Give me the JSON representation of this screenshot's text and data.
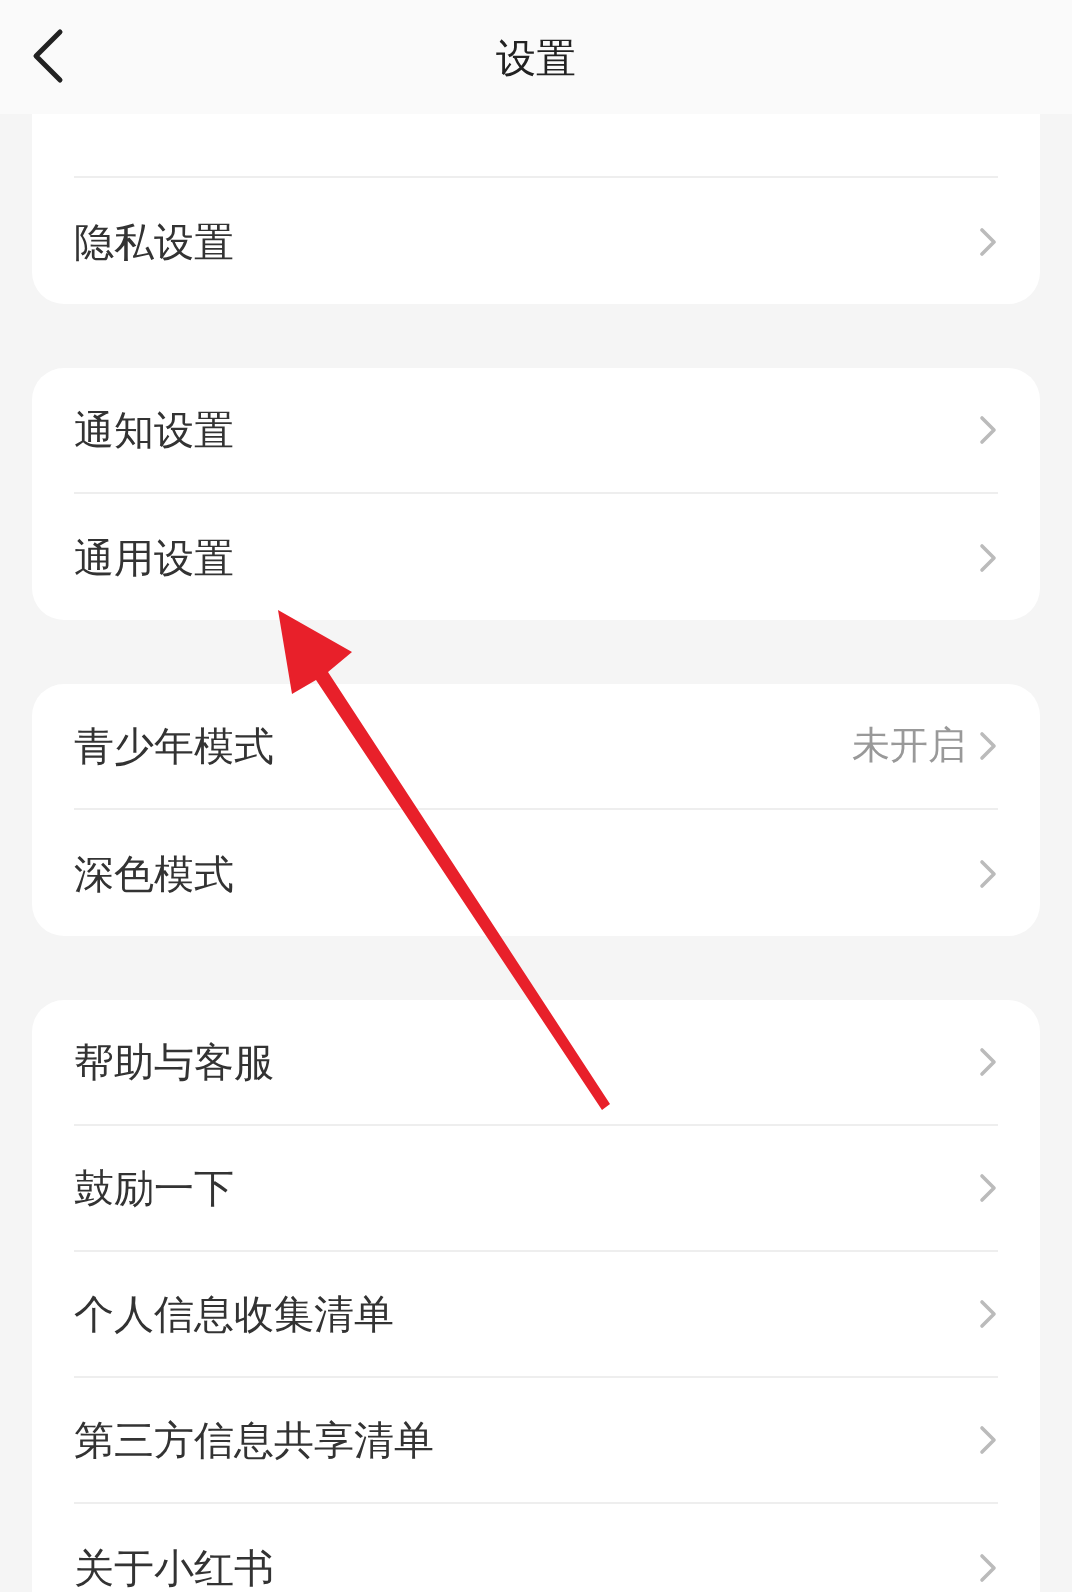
{
  "header": {
    "title": "设置"
  },
  "groups": [
    {
      "partial_top": true,
      "items": [
        {
          "label": "隐私设置"
        }
      ]
    },
    {
      "items": [
        {
          "label": "通知设置"
        },
        {
          "label": "通用设置"
        }
      ]
    },
    {
      "items": [
        {
          "label": "青少年模式",
          "value": "未开启"
        },
        {
          "label": "深色模式"
        }
      ]
    },
    {
      "items": [
        {
          "label": "帮助与客服"
        },
        {
          "label": "鼓励一下"
        },
        {
          "label": "个人信息收集清单"
        },
        {
          "label": "第三方信息共享清单"
        },
        {
          "label": "关于小红书"
        }
      ]
    }
  ],
  "annotation": {
    "kind": "arrow"
  }
}
